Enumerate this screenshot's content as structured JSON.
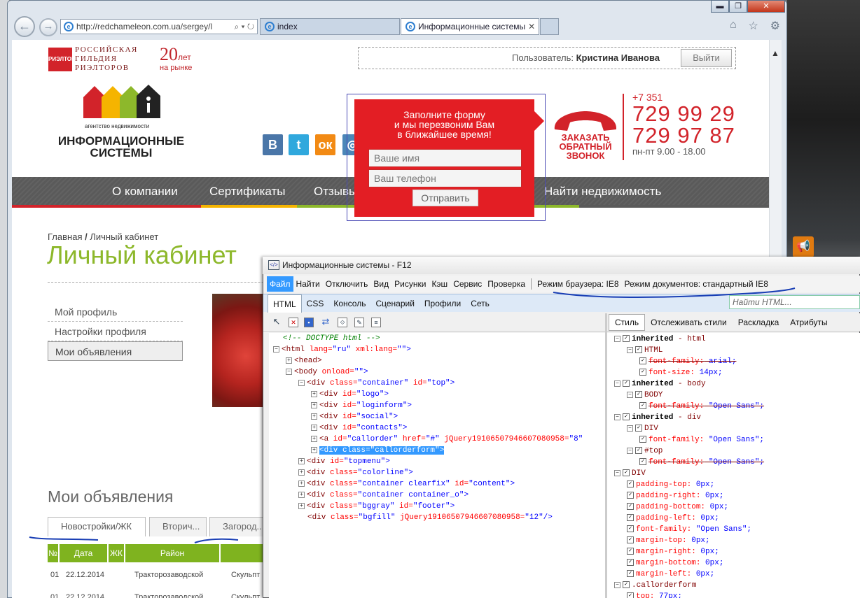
{
  "browser": {
    "url": "http://redchameleon.com.ua/sergey/l",
    "tabs": [
      {
        "label": "index"
      },
      {
        "label": "Информационные системы"
      }
    ],
    "ie_logo": "e",
    "window_controls": {
      "minimize": "▬",
      "maximize": "❐",
      "close": "✕"
    },
    "tab_close": "✕"
  },
  "site": {
    "rgr_logo": "РИЭЛТОР",
    "rgr_text": "РОССИЙСКАЯ\nГИЛЬДИЯ\nРИЭЛТОРОВ",
    "years": "20",
    "years_suffix": "лет",
    "years_sub": "на рынке",
    "agency_small": "агентство недвижимости",
    "company": "ИНФОРМАЦИОННЫЕ\nСИСТЕМЫ",
    "user_label": "Пользователь:",
    "user_name": "Кристина Иванова",
    "logout": "Выйти",
    "social": {
      "vk": "В",
      "tw": "t",
      "ok": "ок",
      "ig": "◎"
    },
    "callback": "ЗАКАЗАТЬ ОБРАТНЫЙ ЗВОНОК",
    "phone_prefix": "+7 351",
    "phone1": "729 99 29",
    "phone2": "729 97 87",
    "hours": "пн-пт 9.00 - 18.00",
    "menu": [
      "О компании",
      "Сертификаты",
      "Отзывы",
      "Найти недвижимость"
    ],
    "colorline": [
      "#d2232a",
      "#f5b400",
      "#5a5a5a",
      "#8db82b",
      "#5a5a5a"
    ],
    "breadcrumb_home": "Главная",
    "breadcrumb_sep": "/",
    "breadcrumb_current": "Личный кабинет",
    "title": "Личный кабинет",
    "sidebar": [
      "Мой профиль",
      "Настройки профиля",
      "Мои объявления"
    ],
    "ads_title": "Мои объявления",
    "ad_tabs": [
      "Новостройки/ЖК",
      "Вторич...",
      "Загород..."
    ],
    "table_headers": [
      "№",
      "Дата",
      "ЖК",
      "Район",
      ""
    ],
    "table_rows": [
      [
        "01",
        "22.12.2014",
        "Тракторозаводской",
        "Скульпт"
      ],
      [
        "01",
        "22.12.2014",
        "Тракторозаводской",
        "Скульпт"
      ]
    ],
    "callform": {
      "text": "Заполните форму\nи мы перезвоним Вам\nв ближайшее время!",
      "name_placeholder": "Ваше имя",
      "phone_placeholder": "Ваш телефон",
      "send": "Отправить"
    }
  },
  "devtools": {
    "title": "Информационные системы - F12",
    "menu": [
      "Файл",
      "Найти",
      "Отключить",
      "Вид",
      "Рисунки",
      "Кэш",
      "Сервис",
      "Проверка",
      "Режим браузера: IE8",
      "Режим документов: стандартный IE8"
    ],
    "tabs": [
      "HTML",
      "CSS",
      "Консоль",
      "Сценарий",
      "Профили",
      "Сеть"
    ],
    "find_placeholder": "Найти HTML...",
    "style_tabs": [
      "Стиль",
      "Отслеживать стили",
      "Раскладка",
      "Атрибуты"
    ],
    "dom": {
      "doctype": "<!-- DOCTYPE html -->",
      "html_open": "<html",
      "html_attrs": " lang=",
      "html_lang": "\"ru\"",
      "html_attr2": " xml:lang=",
      "html_val2": "\"\">",
      "head": "<head>",
      "body_open": "<body",
      "body_attr": " onload=",
      "body_val": "\"\">",
      "nodes": [
        {
          "tag": "<div",
          "attr": " class=",
          "val": "\"container\"",
          "attr2": " id=",
          "val2": "\"top\">"
        },
        {
          "tag": "<div",
          "attr": " id=",
          "val": "\"logo\">"
        },
        {
          "tag": "<div",
          "attr": " id=",
          "val": "\"loginform\">"
        },
        {
          "tag": "<div",
          "attr": " id=",
          "val": "\"social\">"
        },
        {
          "tag": "<div",
          "attr": " id=",
          "val": "\"contacts\">"
        },
        {
          "tag": "<a",
          "attr": " id=",
          "val": "\"callorder\"",
          "attr2": " href=",
          "val2": "\"#\"",
          "attr3": " jQuery19106507946607080958=",
          "val3": "\"8\""
        },
        {
          "selected": "<div class=\"callorderform\">"
        },
        {
          "tag": "<div",
          "attr": " id=",
          "val": "\"topmenu\">"
        },
        {
          "tag": "<div",
          "attr": " class=",
          "val": "\"colorline\">"
        },
        {
          "tag": "<div",
          "attr": " class=",
          "val": "\"container clearfix\"",
          "attr2": " id=",
          "val2": "\"content\">"
        },
        {
          "tag": "<div",
          "attr": " class=",
          "val": "\"container container_o\">"
        },
        {
          "tag": "<div",
          "attr": " class=",
          "val": "\"bggray\"",
          "attr2": " id=",
          "val2": "\"footer\">"
        },
        {
          "tag": "<div",
          "attr": " class=",
          "val": "\"bgfill\"",
          "attr2": " jQuery19106507946607080958=",
          "val2": "\"12\"/>"
        }
      ]
    },
    "styles": [
      {
        "kind": "head",
        "a": "inherited",
        "b": " - html"
      },
      {
        "kind": "sel",
        "text": "HTML"
      },
      {
        "kind": "prop",
        "p": "font-family:",
        "v": " arial;",
        "strike": true
      },
      {
        "kind": "prop",
        "p": "font-size:",
        "v": " 14px;"
      },
      {
        "kind": "head",
        "a": "inherited",
        "b": " - body"
      },
      {
        "kind": "sel",
        "text": "BODY"
      },
      {
        "kind": "prop",
        "p": "font-family:",
        "v": " \"Open Sans\";",
        "strike": true
      },
      {
        "kind": "head",
        "a": "inherited",
        "b": " - div"
      },
      {
        "kind": "sel",
        "text": "DIV"
      },
      {
        "kind": "prop",
        "p": "font-family:",
        "v": " \"Open Sans\";"
      },
      {
        "kind": "sel",
        "text": "#top"
      },
      {
        "kind": "prop",
        "p": "font-family:",
        "v": " \"Open Sans\";",
        "strike": true
      },
      {
        "kind": "sel0",
        "text": "DIV"
      },
      {
        "kind": "prop1",
        "p": "padding-top:",
        "v": " 0px;"
      },
      {
        "kind": "prop1",
        "p": "padding-right:",
        "v": " 0px;"
      },
      {
        "kind": "prop1",
        "p": "padding-bottom:",
        "v": " 0px;"
      },
      {
        "kind": "prop1",
        "p": "padding-left:",
        "v": " 0px;"
      },
      {
        "kind": "prop1",
        "p": "font-family:",
        "v": " \"Open Sans\";"
      },
      {
        "kind": "prop1",
        "p": "margin-top:",
        "v": " 0px;"
      },
      {
        "kind": "prop1",
        "p": "margin-right:",
        "v": " 0px;"
      },
      {
        "kind": "prop1",
        "p": "margin-bottom:",
        "v": " 0px;"
      },
      {
        "kind": "prop1",
        "p": "margin-left:",
        "v": " 0px;"
      },
      {
        "kind": "sel0",
        "text": ".callorderform"
      },
      {
        "kind": "prop1",
        "p": "top:",
        "v": " 77px;"
      }
    ]
  }
}
